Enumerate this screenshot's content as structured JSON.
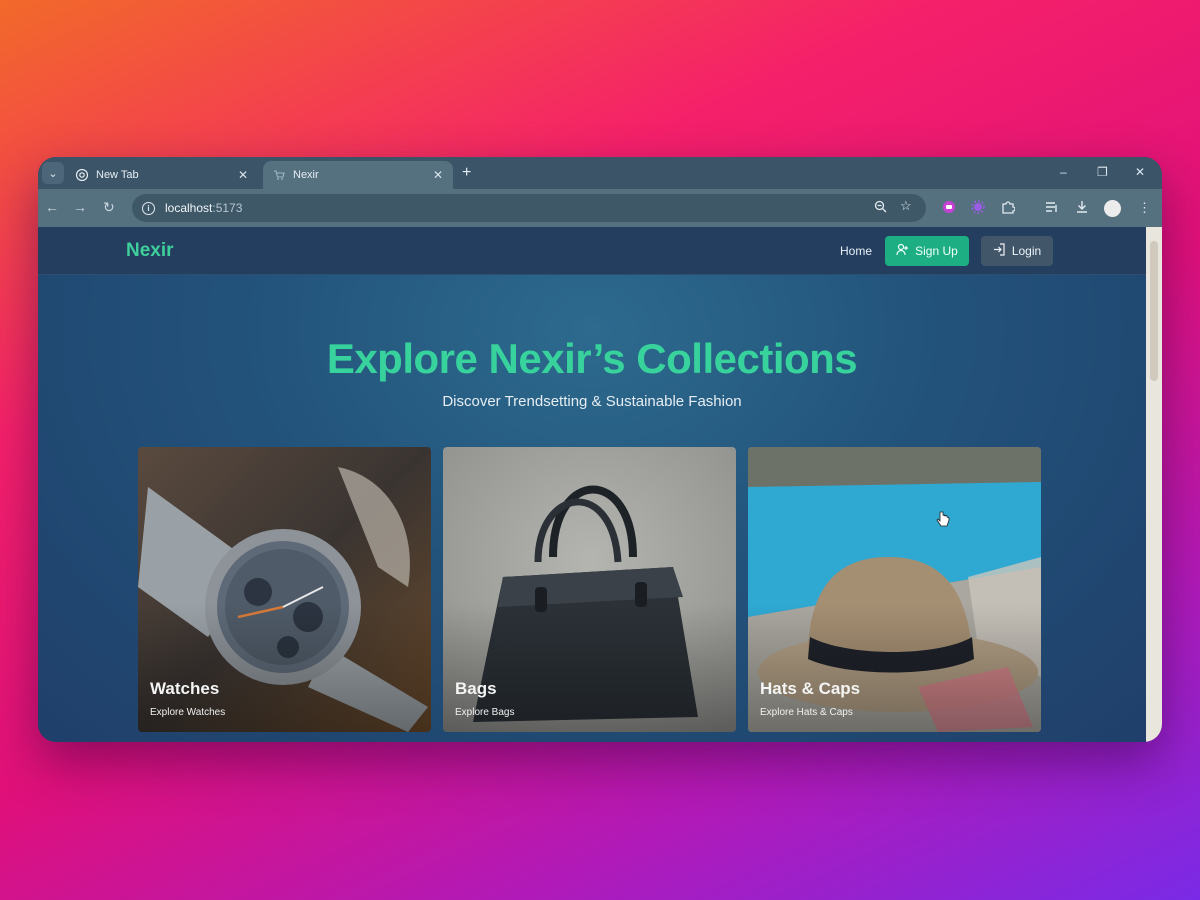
{
  "browser": {
    "tabs": [
      {
        "title": "New Tab",
        "active": false
      },
      {
        "title": "Nexir",
        "active": true
      }
    ],
    "new_tab": "+",
    "window_controls": {
      "minimize": "–",
      "restore": "❐",
      "close": "✕"
    },
    "address": {
      "host": "localhost",
      "port": ":5173"
    }
  },
  "page": {
    "brand": "Nexir",
    "nav": {
      "home": "Home",
      "signup": "Sign Up",
      "login": "Login"
    },
    "hero": {
      "title": "Explore Nexir’s Collections",
      "subtitle": "Discover Trendsetting & Sustainable Fashion"
    },
    "cards": [
      {
        "name": "Watches",
        "link": "Explore Watches"
      },
      {
        "name": "Bags",
        "link": "Explore Bags"
      },
      {
        "name": "Hats & Caps",
        "link": "Explore Hats & Caps"
      }
    ]
  },
  "colors": {
    "brand": "#3ecf9a",
    "signup_button": "#1eae84",
    "login_button": "#42566a",
    "navbar": "#233e5f"
  },
  "icons": [
    "tab-search-icon",
    "chrome-icon",
    "cart-icon",
    "back-icon",
    "forward-icon",
    "reload-icon",
    "site-info-icon",
    "zoom-icon",
    "bookmark-star-icon",
    "extensions-icon",
    "reading-list-icon",
    "download-icon",
    "profile-avatar",
    "menu-kebab-icon",
    "add-user-icon",
    "login-icon",
    "pointer-cursor"
  ]
}
